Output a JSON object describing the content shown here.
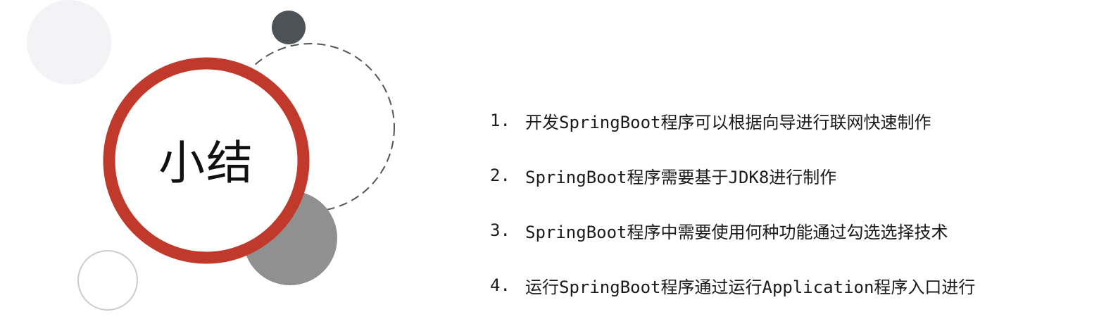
{
  "title": "小结",
  "items": [
    {
      "num": "1.",
      "text": "开发SpringBoot程序可以根据向导进行联网快速制作"
    },
    {
      "num": "2.",
      "text": "SpringBoot程序需要基于JDK8进行制作"
    },
    {
      "num": "3.",
      "text": "SpringBoot程序中需要使用何种功能通过勾选选择技术"
    },
    {
      "num": "4.",
      "text": "运行SpringBoot程序通过运行Application程序入口进行"
    }
  ],
  "colors": {
    "accent_ring": "#c0392b",
    "dark_dot": "#4d5256",
    "gray_circle": "#909090",
    "light_circle": "#f3f2f4",
    "outline_circle": "#cccccc",
    "dashed": "#555555"
  }
}
